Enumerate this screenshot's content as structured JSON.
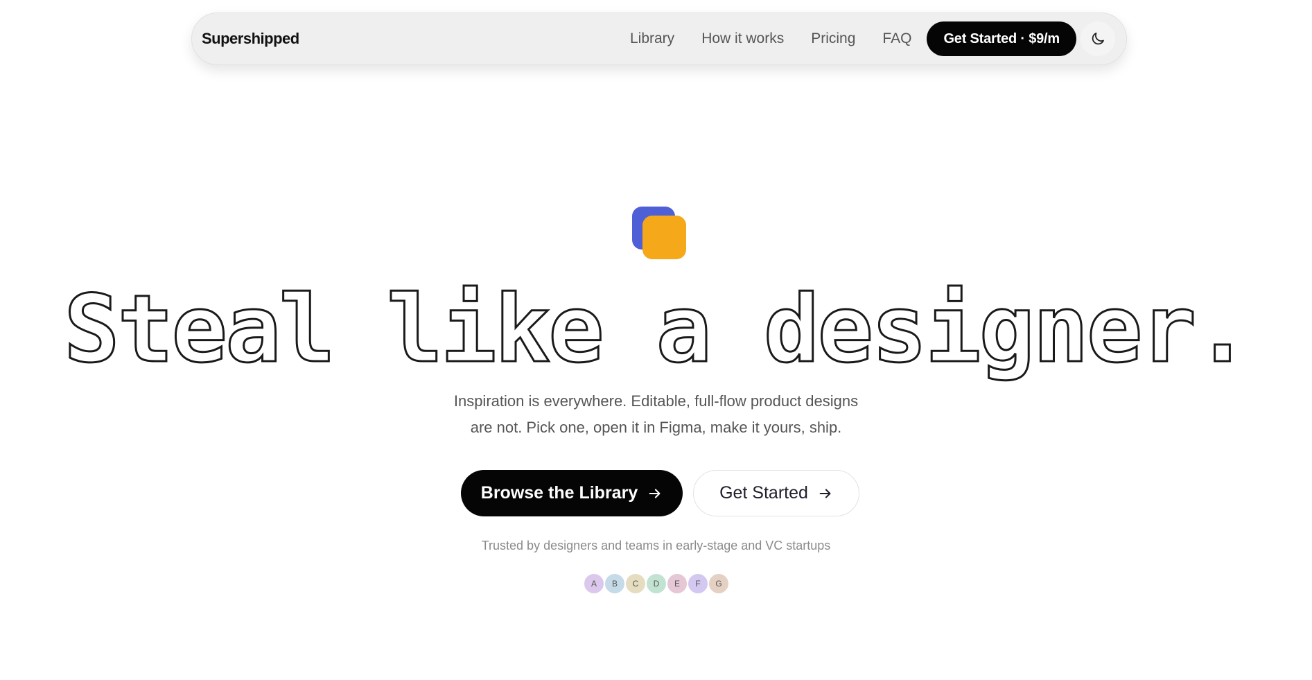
{
  "nav": {
    "brand": "Supershipped",
    "links": [
      "Library",
      "How it works",
      "Pricing",
      "FAQ"
    ],
    "cta_label": "Get Started · $9/m",
    "theme_toggle_icon": "moon-icon"
  },
  "hero": {
    "logo_colors": {
      "back": "#4f5fd6",
      "front": "#f5a81a"
    },
    "headline": "Steal like a designer.",
    "subtext_line1": "Inspiration is everywhere. Editable, full-flow product designs",
    "subtext_line2": "are not. Pick one, open it in Figma, make it yours, ship.",
    "primary_button": "Browse the Library",
    "secondary_button": "Get Started",
    "button_icon": "arrow-right-icon",
    "trust_text": "Trusted by designers and teams in early-stage and VC startups",
    "avatars": [
      {
        "initial": "A",
        "color": "#dcc8ec"
      },
      {
        "initial": "B",
        "color": "#c6dbe8"
      },
      {
        "initial": "C",
        "color": "#e6dcc0"
      },
      {
        "initial": "D",
        "color": "#c2e3d2"
      },
      {
        "initial": "E",
        "color": "#e5c7d5"
      },
      {
        "initial": "F",
        "color": "#d3c8ef"
      },
      {
        "initial": "G",
        "color": "#e5d1c3"
      }
    ]
  }
}
